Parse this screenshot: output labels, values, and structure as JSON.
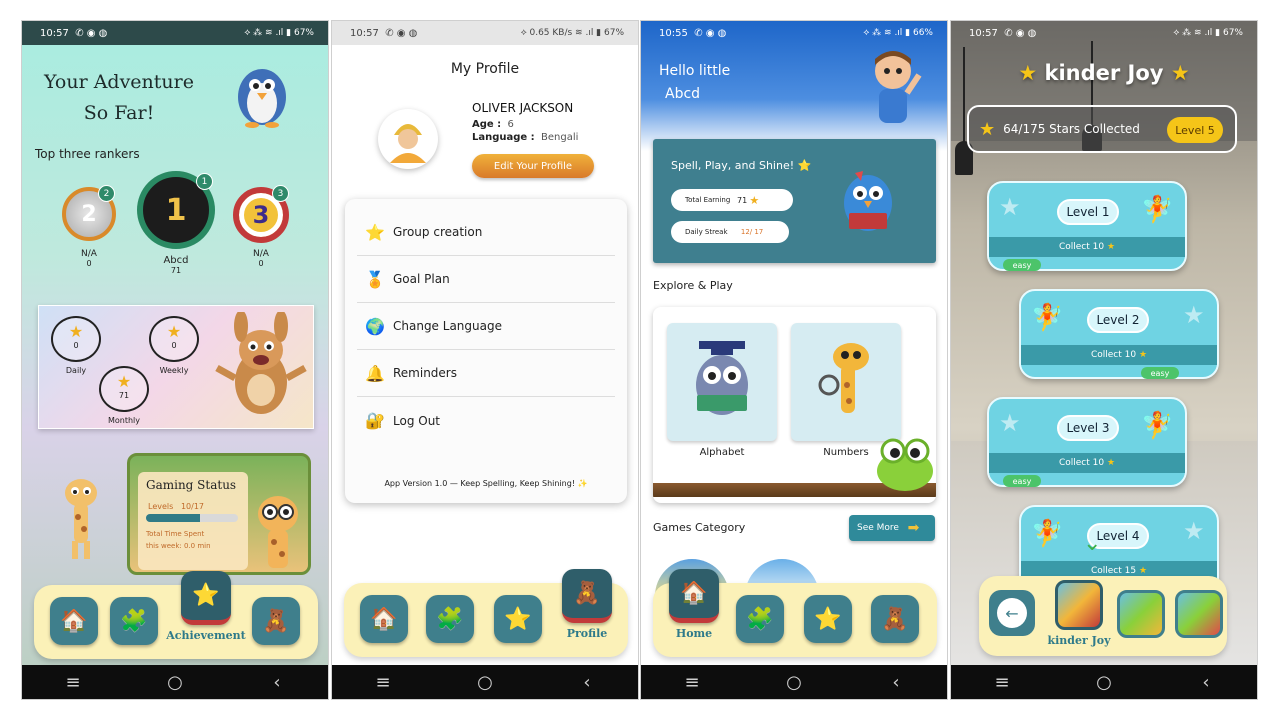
{
  "colors": {
    "accent_teal": "#3f7f8c",
    "dock_bg": "#fbf1b8",
    "profile_button": "#e8962e",
    "level_badge": "#f5c518",
    "easy_badge": "#4cc46a"
  },
  "icons": {
    "home": "house-icon",
    "puzzle": "puzzle-icon",
    "star": "star-icon",
    "bear": "teddy-bear-icon",
    "back": "arrow-left-icon"
  },
  "system": {
    "nav_menu": "≡",
    "nav_home": "○",
    "nav_back": "‹"
  },
  "achievement": {
    "status_time": "10:57",
    "status_icons": "✆ ◉ ◍",
    "status_right": "⟡ ⁂ ≋ .ıl ▮ 67%",
    "title": "Your Adventure So Far!",
    "rankers_heading": "Top three rankers",
    "rankers": [
      {
        "rank": "2",
        "medal": "2",
        "name": "N/A",
        "score": "0"
      },
      {
        "rank": "1",
        "medal": "1",
        "name": "Abcd",
        "score": "71"
      },
      {
        "rank": "3",
        "medal": "3",
        "name": "N/A",
        "score": "0"
      }
    ],
    "stats": [
      {
        "label": "Daily",
        "value": "0"
      },
      {
        "label": "Weekly",
        "value": "0"
      },
      {
        "label": "Monthly",
        "value": "71"
      }
    ],
    "gaming_title": "Gaming Status",
    "levels_label": "Levels",
    "levels_value": "10/17",
    "levels_progress": 0.59,
    "time_label": "Total Time Spent",
    "time_value": "this week: 0.0 min",
    "dock_label": "Achievement"
  },
  "profile": {
    "status_time": "10:57",
    "status_icons": "✆ ◉ ◍",
    "status_right": "⟡ 0.65 KB/s ≋ .ıl ▮ 67%",
    "title": "My Profile",
    "name": "OLIVER JACKSON",
    "age_label": "Age :",
    "age_value": "6",
    "lang_label": "Language :",
    "lang_value": "Bengali",
    "edit_button": "Edit Your Profile",
    "menu": [
      {
        "icon": "⭐",
        "label": "Group creation"
      },
      {
        "icon": "🏅",
        "label": "Goal Plan"
      },
      {
        "icon": "🌍",
        "label": "Change Language"
      },
      {
        "icon": "🔔",
        "label": "Reminders"
      },
      {
        "icon": "🔐",
        "label": "Log Out"
      }
    ],
    "version": "App Version 1.0 — Keep Spelling, Keep Shining! ✨",
    "dock_label": "Profile"
  },
  "home": {
    "status_time": "10:55",
    "status_icons": "✆ ◉ ◍",
    "status_right": "⟡ ⁂ ≋ .ıl ▮ 66%",
    "greeting_line1": "Hello little",
    "greeting_line2": "Abcd",
    "card_title": "Spell, Play, and Shine! ⭐",
    "earning_label": "Total Earning",
    "earning_value": "71",
    "streak_label": "Daily Streak",
    "streak_value": "12/ 17",
    "explore_heading": "Explore & Play",
    "tiles": [
      {
        "label": "Alphabet"
      },
      {
        "label": "Numbers"
      }
    ],
    "games_heading": "Games Category",
    "see_more": "See More",
    "dock_label": "Home"
  },
  "levels": {
    "status_time": "10:57",
    "status_icons": "✆ ◉ ◍",
    "status_right": "⟡ ⁂ ≋ .ıl ▮ 67%",
    "title": "kinder Joy",
    "stars_collected": "64/175 Stars Collected",
    "level_badge": "Level 5",
    "cards": [
      {
        "name": "Level 1",
        "collect": "Collect 10",
        "difficulty": "easy"
      },
      {
        "name": "Level 2",
        "collect": "Collect 10",
        "difficulty": "easy"
      },
      {
        "name": "Level 3",
        "collect": "Collect 10",
        "difficulty": "easy"
      },
      {
        "name": "Level 4",
        "collect": "Collect 15",
        "difficulty": ""
      }
    ],
    "dock_label": "kinder Joy"
  }
}
